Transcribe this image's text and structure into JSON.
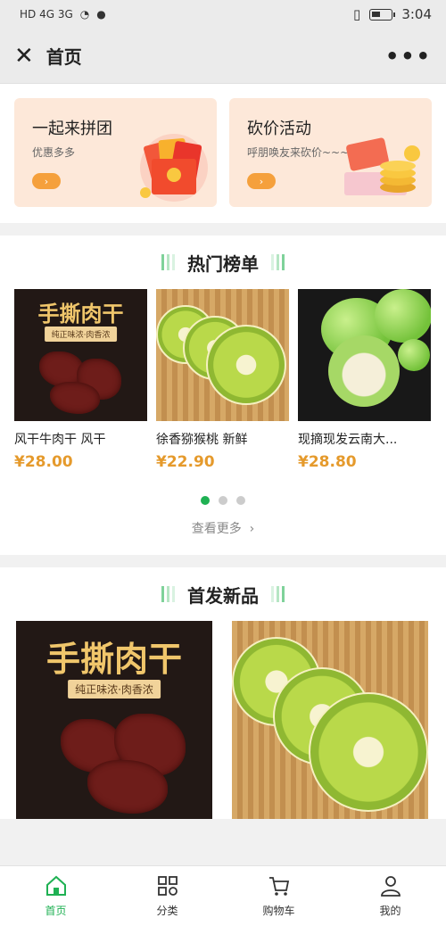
{
  "status_bar": {
    "left": "HD 4G 3G",
    "time": "3:04"
  },
  "navbar": {
    "title": "首页",
    "close_icon": "close-icon",
    "more_icon": "more-icon"
  },
  "promos": [
    {
      "title": "一起来拼团",
      "subtitle": "优惠多多"
    },
    {
      "title": "砍价活动",
      "subtitle": "呼朋唤友来砍价~~~"
    }
  ],
  "hot": {
    "title": "热门榜单",
    "items": [
      {
        "name": "风干牛肉干 风干",
        "price": "¥28.00",
        "img": "beef-jerky"
      },
      {
        "name": "徐香猕猴桃 新鲜",
        "price": "¥22.90",
        "img": "kiwi"
      },
      {
        "name": "现摘现发云南大...",
        "price": "¥28.80",
        "img": "green-jujube"
      }
    ],
    "view_more": "查看更多"
  },
  "new": {
    "title": "首发新品",
    "items": [
      {
        "img": "beef-jerky"
      },
      {
        "img": "kiwi"
      }
    ]
  },
  "jerky_text": {
    "title": "手撕肉干",
    "tag": "纯正味浓·肉香浓"
  },
  "tabs": [
    {
      "label": "首页",
      "icon": "home-icon",
      "active": true
    },
    {
      "label": "分类",
      "icon": "category-icon"
    },
    {
      "label": "购物车",
      "icon": "cart-icon"
    },
    {
      "label": "我的",
      "icon": "user-icon"
    }
  ],
  "colors": {
    "accent": "#1fb153",
    "price": "#e59a2c",
    "promo_bg": "#fde8d9"
  }
}
